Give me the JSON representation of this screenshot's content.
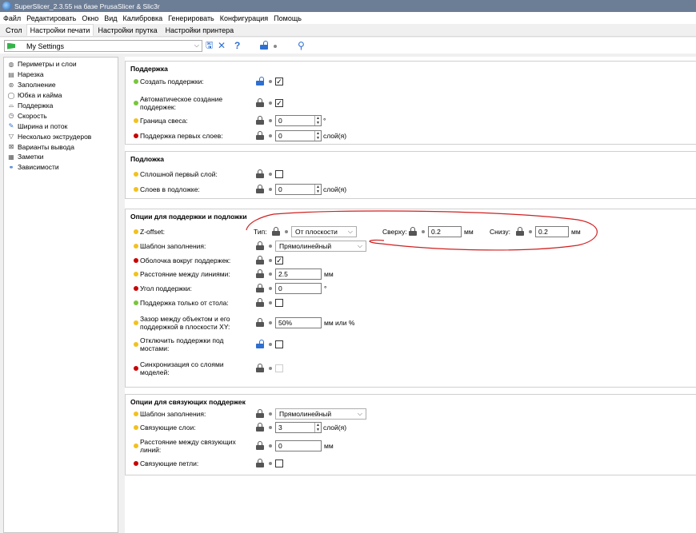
{
  "window": {
    "title": "SuperSlicer_2.3.55 на базе PrusaSlicer & Slic3r"
  },
  "menu": [
    "Файл",
    "Редактировать",
    "Окно",
    "Вид",
    "Калибровка",
    "Генерировать",
    "Конфигурация",
    "Помощь"
  ],
  "tabs": [
    "Стол",
    "Настройки печати",
    "Настройки прутка",
    "Настройки принтера"
  ],
  "preset": {
    "name": "My Settings"
  },
  "sidebar": {
    "items": [
      {
        "label": "Периметры и слои",
        "icon": "layers-icon"
      },
      {
        "label": "Нарезка",
        "icon": "slicing-icon"
      },
      {
        "label": "Заполнение",
        "icon": "infill-icon"
      },
      {
        "label": "Юбка и кайма",
        "icon": "skirt-icon"
      },
      {
        "label": "Поддержка",
        "icon": "support-icon"
      },
      {
        "label": "Скорость",
        "icon": "speed-icon"
      },
      {
        "label": "Ширина и поток",
        "icon": "width-icon"
      },
      {
        "label": "Несколько экструдеров",
        "icon": "extruder-icon"
      },
      {
        "label": "Варианты вывода",
        "icon": "output-icon"
      },
      {
        "label": "Заметки",
        "icon": "notes-icon"
      },
      {
        "label": "Зависимости",
        "icon": "dependencies-icon"
      }
    ]
  },
  "groups": {
    "support": {
      "title": "Поддержка",
      "create_label": "Создать поддержки:",
      "auto_label": "Автоматическое создание поддержек:",
      "overhang_label": "Граница свеса:",
      "overhang_value": "0",
      "overhang_unit": "°",
      "first_layers_label": "Поддержка первых слоев:",
      "first_layers_value": "0",
      "first_layers_unit": "слой(я)"
    },
    "raft": {
      "title": "Подложка",
      "solid_first_label": "Сплошной первый слой:",
      "raft_layers_label": "Слоев в подложке:",
      "raft_layers_value": "0",
      "raft_layers_unit": "слой(я)"
    },
    "options": {
      "title": "Опции для поддержки и подложки",
      "zoffset_label": "Z-offset:",
      "type_label": "Тип:",
      "type_value": "От плоскости",
      "top_label": "Сверху:",
      "top_value": "0.2",
      "top_unit": "мм",
      "bottom_label": "Снизу:",
      "bottom_value": "0.2",
      "bottom_unit": "мм",
      "pattern_label": "Шаблон заполнения:",
      "pattern_value": "Прямолинейный",
      "shell_label": "Оболочка вокруг поддержек:",
      "spacing_label": "Расстояние между линиями:",
      "spacing_value": "2.5",
      "spacing_unit": "мм",
      "angle_label": "Угол поддержки:",
      "angle_value": "0",
      "angle_unit": "°",
      "buildplate_label": "Поддержка только от стола:",
      "xy_gap_label": "Зазор между объектом и его поддержкой в плоскости XY:",
      "xy_gap_value": "50%",
      "xy_gap_unit": "мм или %",
      "bridges_label": "Отключить поддержки под мостами:",
      "sync_label": "Синхронизация со слоями моделей:"
    },
    "interface": {
      "title": "Опции для связующих поддержек",
      "pattern_label": "Шаблон заполнения:",
      "pattern_value": "Прямолинейный",
      "layers_label": "Связующие слои:",
      "layers_value": "3",
      "layers_unit": "слой(я)",
      "spacing_label": "Расстояние между связующих линий:",
      "spacing_value": "0",
      "spacing_unit": "мм",
      "loops_label": "Связующие петли:"
    }
  },
  "colors": {
    "titlebar": "#6c7d96",
    "unlocked": "#2e6fd0",
    "annotation": "#d02020"
  }
}
